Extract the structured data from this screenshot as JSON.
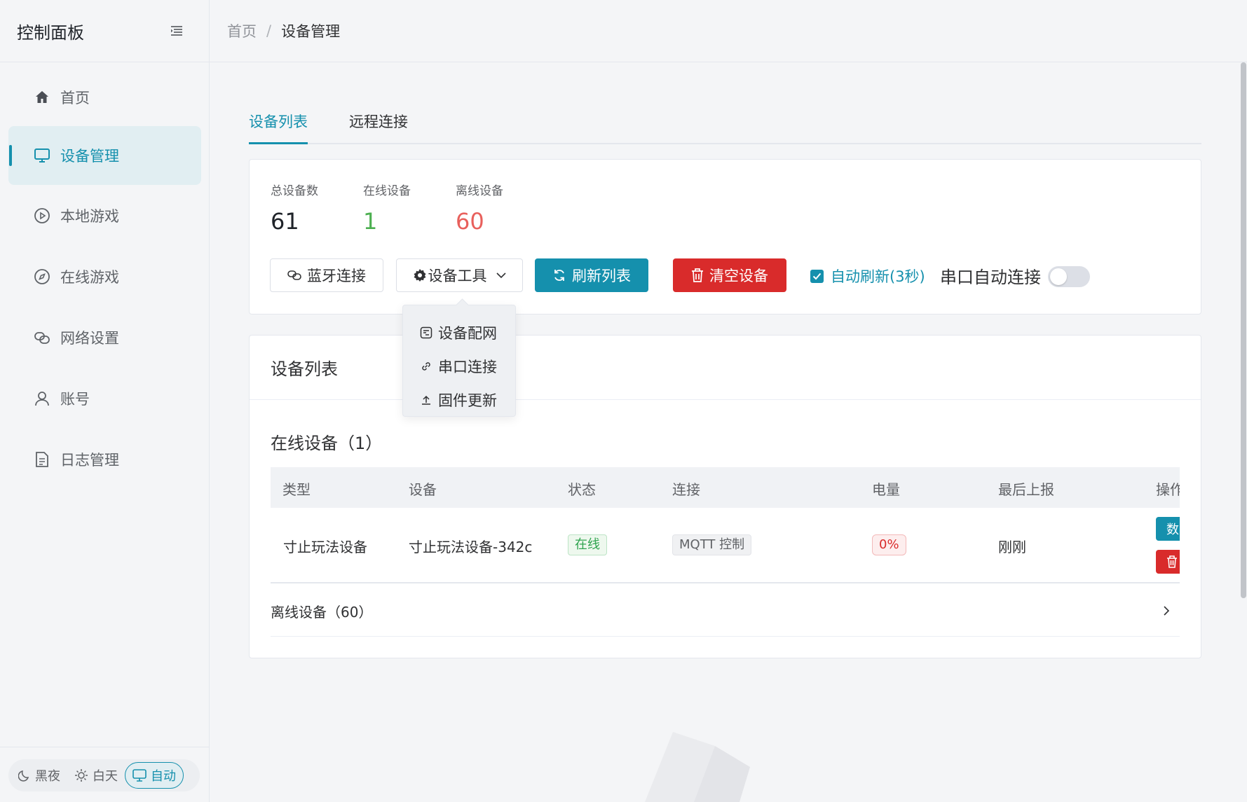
{
  "sidebar": {
    "title": "控制面板",
    "items": [
      {
        "label": "首页",
        "icon": "home-icon"
      },
      {
        "label": "设备管理",
        "icon": "monitor-icon",
        "active": true
      },
      {
        "label": "本地游戏",
        "icon": "play-circle-icon"
      },
      {
        "label": "在线游戏",
        "icon": "compass-icon"
      },
      {
        "label": "网络设置",
        "icon": "link-icon"
      },
      {
        "label": "账号",
        "icon": "user-icon"
      },
      {
        "label": "日志管理",
        "icon": "document-icon"
      }
    ],
    "theme": {
      "dark": "黑夜",
      "light": "白天",
      "auto": "自动",
      "selected": "自动"
    }
  },
  "breadcrumb": {
    "home": "首页",
    "separator": "/",
    "current": "设备管理"
  },
  "tabs": [
    {
      "label": "设备列表",
      "active": true
    },
    {
      "label": "远程连接",
      "active": false
    }
  ],
  "stats": {
    "total": {
      "label": "总设备数",
      "value": "61"
    },
    "online": {
      "label": "在线设备",
      "value": "1"
    },
    "offline": {
      "label": "离线设备",
      "value": "60"
    }
  },
  "toolbar": {
    "bluetooth": "蓝牙连接",
    "tools": "设备工具",
    "refresh": "刷新列表",
    "clear": "清空设备",
    "auto_refresh": "自动刷新(3秒)",
    "auto_refresh_checked": true,
    "serial_auto": "串口自动连接",
    "serial_auto_on": false
  },
  "tools_menu": [
    "设备配网",
    "串口连接",
    "固件更新"
  ],
  "device_list": {
    "title": "设备列表",
    "online_section": "在线设备（1）",
    "columns": [
      "类型",
      "设备",
      "状态",
      "连接",
      "电量",
      "最后上报",
      "操作"
    ],
    "rows": [
      {
        "type": "寸止玩法设备",
        "device": "寸止玩法设备-342c",
        "status": "在线",
        "connection": "MQTT 控制",
        "battery": "0%",
        "last_report": "刚刚",
        "actions": [
          "数",
          "delete"
        ]
      }
    ],
    "offline_section": "离线设备（60）"
  },
  "colors": {
    "primary": "#1590ad",
    "danger": "#d92b2b",
    "success": "#4caf50",
    "offline_value": "#e8605c"
  }
}
